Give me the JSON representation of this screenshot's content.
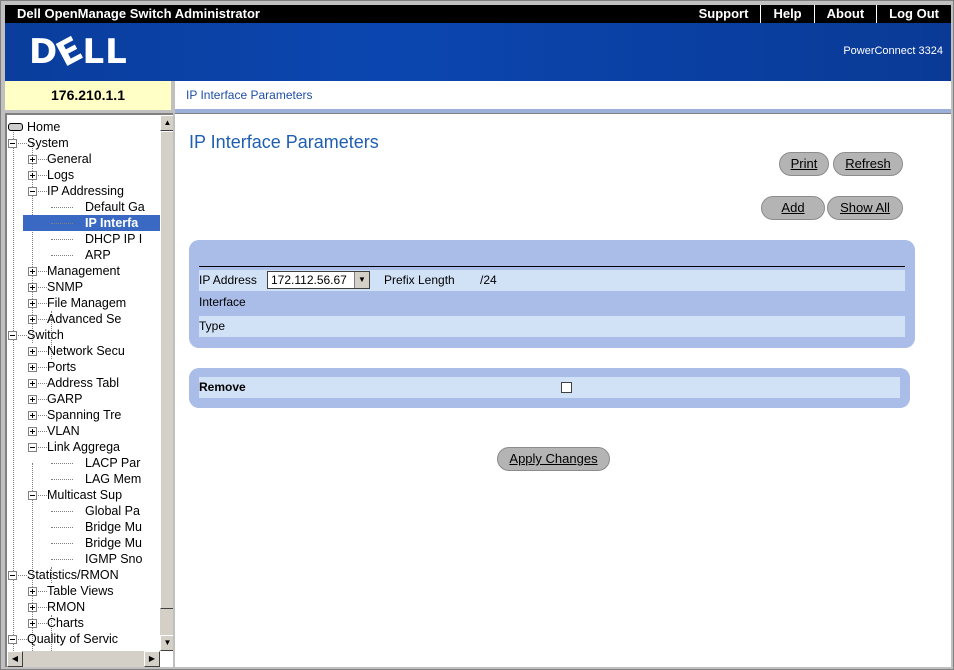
{
  "app": {
    "title": "Dell OpenManage Switch Administrator",
    "links": [
      "Support",
      "Help",
      "About",
      "Log Out"
    ],
    "logo": "DELL",
    "product": "PowerConnect 3324",
    "ip": "176.210.1.1",
    "breadcrumb": "IP Interface Parameters"
  },
  "tree": {
    "items": [
      {
        "label": "Home",
        "level": 0,
        "exp": "minus"
      },
      {
        "label": "System",
        "level": 1,
        "exp": "minus"
      },
      {
        "label": "General",
        "level": 2,
        "exp": "plus"
      },
      {
        "label": "Logs",
        "level": 2,
        "exp": "plus"
      },
      {
        "label": "IP Addressing",
        "level": 2,
        "exp": "minus"
      },
      {
        "label": "Default Ga",
        "level": 3
      },
      {
        "label": "IP Interfa",
        "level": 3,
        "selected": true
      },
      {
        "label": "DHCP IP I",
        "level": 3
      },
      {
        "label": "ARP",
        "level": 3
      },
      {
        "label": "Management",
        "level": 2,
        "exp": "plus"
      },
      {
        "label": "SNMP",
        "level": 2,
        "exp": "plus"
      },
      {
        "label": "File Managem",
        "level": 2,
        "exp": "plus"
      },
      {
        "label": "Advanced Se",
        "level": 2,
        "exp": "plus"
      },
      {
        "label": "Switch",
        "level": 1,
        "exp": "minus"
      },
      {
        "label": "Network Secu",
        "level": 2,
        "exp": "plus"
      },
      {
        "label": "Ports",
        "level": 2,
        "exp": "plus"
      },
      {
        "label": "Address Tabl",
        "level": 2,
        "exp": "plus"
      },
      {
        "label": "GARP",
        "level": 2,
        "exp": "plus"
      },
      {
        "label": "Spanning Tre",
        "level": 2,
        "exp": "plus"
      },
      {
        "label": "VLAN",
        "level": 2,
        "exp": "plus"
      },
      {
        "label": "Link Aggrega",
        "level": 2,
        "exp": "minus"
      },
      {
        "label": "LACP Par",
        "level": 3
      },
      {
        "label": "LAG Mem",
        "level": 3
      },
      {
        "label": "Multicast Sup",
        "level": 2,
        "exp": "minus"
      },
      {
        "label": "Global Pa",
        "level": 3
      },
      {
        "label": "Bridge Mu",
        "level": 3
      },
      {
        "label": "Bridge Mu",
        "level": 3
      },
      {
        "label": "IGMP Sno",
        "level": 3
      },
      {
        "label": "Statistics/RMON",
        "level": 1,
        "exp": "minus"
      },
      {
        "label": "Table Views",
        "level": 2,
        "exp": "plus"
      },
      {
        "label": "RMON",
        "level": 2,
        "exp": "plus"
      },
      {
        "label": "Charts",
        "level": 2,
        "exp": "plus"
      },
      {
        "label": "Quality of Servic",
        "level": 1,
        "exp": "minus"
      }
    ]
  },
  "main": {
    "title": "IP Interface Parameters",
    "buttons": {
      "print": "Print",
      "refresh": "Refresh",
      "add": "Add",
      "show_all": "Show All",
      "apply": "Apply Changes"
    },
    "form": {
      "ip_label": "IP Address",
      "ip_value": "172.112.56.67",
      "prefix_label": "Prefix Length",
      "prefix_value": "/24",
      "interface_label": "Interface",
      "type_label": "Type",
      "remove_label": "Remove",
      "remove_checked": false
    }
  }
}
